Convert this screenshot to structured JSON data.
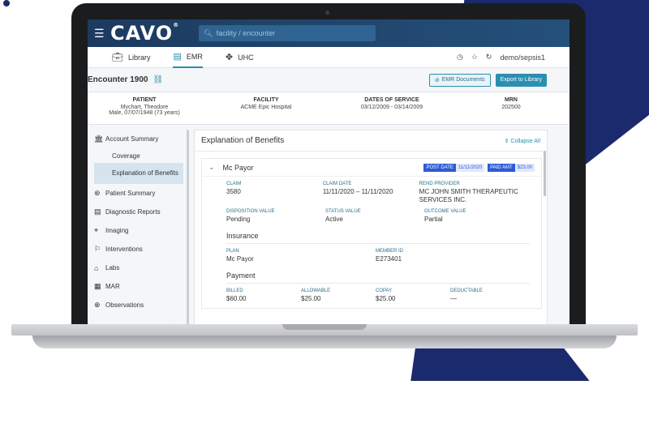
{
  "app": {
    "logo": "CAVO",
    "search_placeholder": "facility / encounter",
    "user": "demo/sepsis1"
  },
  "tabs": [
    {
      "label": "Library",
      "icon": "briefcase-icon"
    },
    {
      "label": "EMR",
      "icon": "document-icon"
    },
    {
      "label": "UHC",
      "icon": "move-icon"
    }
  ],
  "encounter": {
    "title": "Encounter 1900",
    "emr_button": "EMR Documents",
    "export_button": "Export to Library"
  },
  "patient": {
    "patient_header": "PATIENT",
    "patient_name": "Mychart, Theodore",
    "patient_info": "Male, 07/07/1948 (73 years)",
    "facility_header": "FACILITY",
    "facility_value": "ACME Epic Hospital",
    "dates_header": "DATES OF SERVICE",
    "dates_value": "03/12/2009 - 03/14/2009",
    "mrn_header": "MRN",
    "mrn_value": "202500"
  },
  "sidebar": {
    "items": [
      {
        "label": "Account Summary",
        "icon": "bank-icon"
      },
      {
        "label": "Coverage"
      },
      {
        "label": "Explanation of Benefits"
      },
      {
        "label": "Patient Summary",
        "icon": "person-icon"
      },
      {
        "label": "Diagnostic Reports",
        "icon": "report-icon"
      },
      {
        "label": "Imaging",
        "icon": "crosshair-icon"
      },
      {
        "label": "Interventions",
        "icon": "flag-icon"
      },
      {
        "label": "Labs",
        "icon": "flask-icon"
      },
      {
        "label": "MAR",
        "icon": "grid-icon"
      },
      {
        "label": "Observations",
        "icon": "observation-icon"
      }
    ]
  },
  "eob": {
    "title": "Explanation of Benefits",
    "collapse": "Collapse All",
    "payor": "Mc Payor",
    "post_date_label": "POST DATE",
    "post_date": "11/11/2020",
    "paid_amt_label": "PAID AMT",
    "paid_amt": "$23.00",
    "claim_label": "CLAIM",
    "claim": "3580",
    "claim_date_label": "CLAIM DATE",
    "claim_date": "11/11/2020 – 11/11/2020",
    "rend_label": "REND PROVIDER",
    "rend": "MC JOHN SMITH THERAPEUTIC SERVICES INC.",
    "disp_label": "DISPOSITION VALUE",
    "disp": "Pending",
    "status_label": "STATUS VALUE",
    "status": "Active",
    "outcome_label": "OUTCOME VALUE",
    "outcome": "Partial",
    "insurance_title": "Insurance",
    "plan_label": "PLAN",
    "plan": "Mc Payor",
    "member_label": "MEMBER ID",
    "member": "E273401",
    "payment_title": "Payment",
    "billed_label": "BILLED",
    "billed": "$60.00",
    "allowable_label": "ALLOWABLE",
    "allowable": "$25.00",
    "copay_label": "COPAY",
    "copay": "$25.00",
    "deductable_label": "DEDUCTABLE",
    "deductable": "—"
  },
  "colors": {
    "header": "#1d3a5f",
    "accent": "#2a8fb1",
    "badge": "#2d5bd6",
    "brand_bg": "#1a2a6c"
  }
}
